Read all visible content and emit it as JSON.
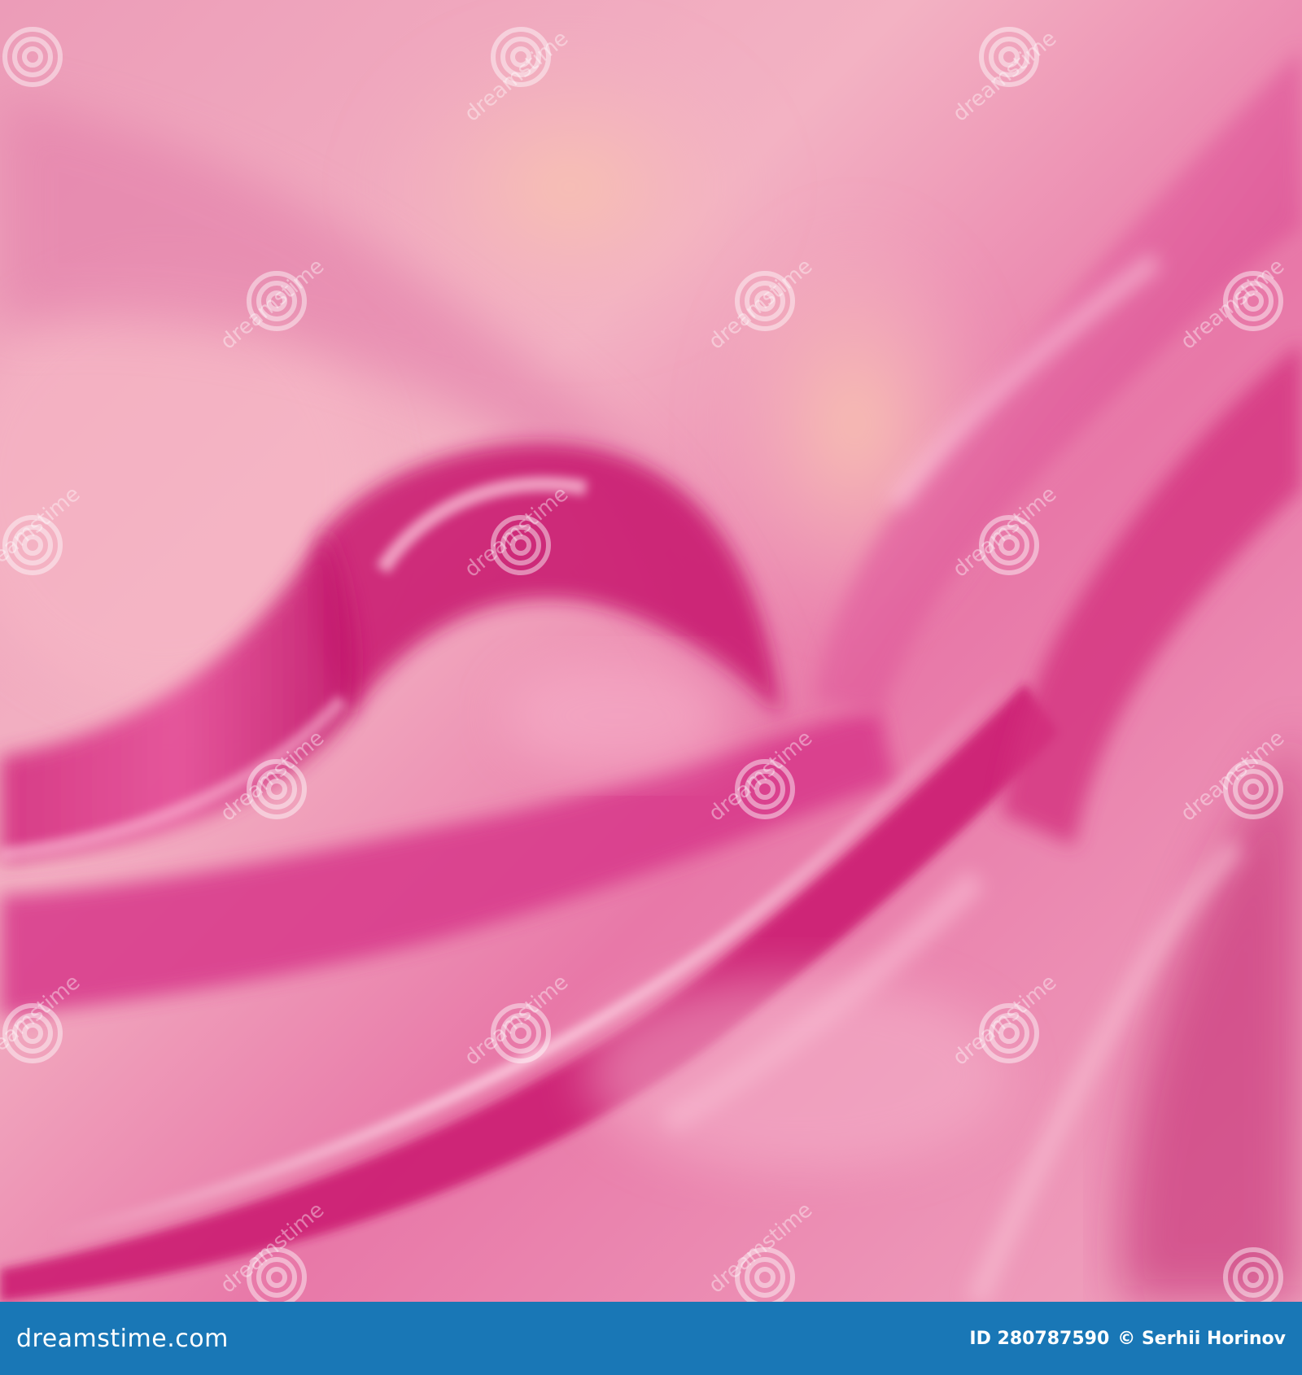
{
  "colors": {
    "footer_bg": "#1977b6",
    "silk_light": "#f2a6bf",
    "silk_mid": "#e6609a",
    "silk_deep": "#d01a73",
    "silk_peach": "#f5b8a8",
    "watermark": "#ffffff"
  },
  "watermark": {
    "text": "dreamstime",
    "icon": "dreamstime-spiral-icon"
  },
  "footer": {
    "brand": "dreamstime.com",
    "image_id": "ID 280787590",
    "credit": "© Serhii Horinov"
  }
}
